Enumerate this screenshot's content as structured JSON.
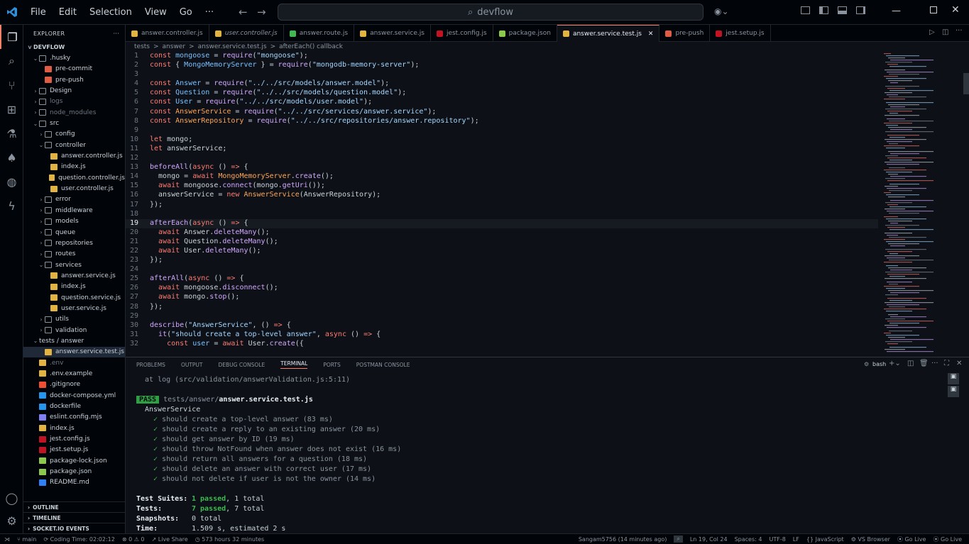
{
  "title_bar": {
    "menu": [
      "File",
      "Edit",
      "Selection",
      "View",
      "Go",
      "···"
    ],
    "search": "devflow"
  },
  "sidebar": {
    "header": "EXPLORER",
    "root": "DEVFLOW",
    "items": [
      {
        "label": ".husky",
        "indent": 1,
        "chev": "v",
        "type": "folder",
        "dim": false
      },
      {
        "label": "pre-commit",
        "indent": 2,
        "chev": "",
        "type": "husky",
        "dim": false
      },
      {
        "label": "pre-push",
        "indent": 2,
        "chev": "",
        "type": "husky",
        "dim": false
      },
      {
        "label": "Design",
        "indent": 1,
        "chev": ">",
        "type": "folder",
        "dim": false
      },
      {
        "label": "logs",
        "indent": 1,
        "chev": ">",
        "type": "folder",
        "dim": true
      },
      {
        "label": "node_modules",
        "indent": 1,
        "chev": ">",
        "type": "folder",
        "dim": true
      },
      {
        "label": "src",
        "indent": 1,
        "chev": "v",
        "type": "folder",
        "dim": false
      },
      {
        "label": "config",
        "indent": 2,
        "chev": ">",
        "type": "folder",
        "dim": false
      },
      {
        "label": "controller",
        "indent": 2,
        "chev": "v",
        "type": "folder",
        "dim": false
      },
      {
        "label": "answer.controller.js",
        "indent": 3,
        "chev": "",
        "type": "gear",
        "dim": false
      },
      {
        "label": "index.js",
        "indent": 3,
        "chev": "",
        "type": "js",
        "dim": false
      },
      {
        "label": "question.controller.js",
        "indent": 3,
        "chev": "",
        "type": "gear",
        "dim": false
      },
      {
        "label": "user.controller.js",
        "indent": 3,
        "chev": "",
        "type": "gear",
        "dim": false
      },
      {
        "label": "error",
        "indent": 2,
        "chev": ">",
        "type": "folder",
        "dim": false
      },
      {
        "label": "middleware",
        "indent": 2,
        "chev": ">",
        "type": "folder",
        "dim": false
      },
      {
        "label": "models",
        "indent": 2,
        "chev": ">",
        "type": "folder",
        "dim": false
      },
      {
        "label": "queue",
        "indent": 2,
        "chev": ">",
        "type": "folder",
        "dim": false
      },
      {
        "label": "repositories",
        "indent": 2,
        "chev": ">",
        "type": "folder",
        "dim": false
      },
      {
        "label": "routes",
        "indent": 2,
        "chev": ">",
        "type": "folder",
        "dim": false
      },
      {
        "label": "services",
        "indent": 2,
        "chev": "v",
        "type": "folder",
        "dim": false
      },
      {
        "label": "answer.service.js",
        "indent": 3,
        "chev": "",
        "type": "svc",
        "dim": false
      },
      {
        "label": "index.js",
        "indent": 3,
        "chev": "",
        "type": "js",
        "dim": false
      },
      {
        "label": "question.service.js",
        "indent": 3,
        "chev": "",
        "type": "svc",
        "dim": false
      },
      {
        "label": "user.service.js",
        "indent": 3,
        "chev": "",
        "type": "svc",
        "dim": false
      },
      {
        "label": "utils",
        "indent": 2,
        "chev": ">",
        "type": "folder",
        "dim": false
      },
      {
        "label": "validation",
        "indent": 2,
        "chev": ">",
        "type": "folder",
        "dim": false
      },
      {
        "label": "tests / answer",
        "indent": 1,
        "chev": "v",
        "type": "none",
        "dim": false
      },
      {
        "label": "answer.service.test.js",
        "indent": 2,
        "chev": "",
        "type": "svc",
        "dim": false,
        "selected": true
      },
      {
        "label": ".env",
        "indent": 1,
        "chev": "",
        "type": "env",
        "dim": true
      },
      {
        "label": ".env.example",
        "indent": 1,
        "chev": "",
        "type": "env",
        "dim": false
      },
      {
        "label": ".gitignore",
        "indent": 1,
        "chev": "",
        "type": "git",
        "dim": false
      },
      {
        "label": "docker-compose.yml",
        "indent": 1,
        "chev": "",
        "type": "docker",
        "dim": false
      },
      {
        "label": "dockerfile",
        "indent": 1,
        "chev": "",
        "type": "docker",
        "dim": false
      },
      {
        "label": "eslint.config.mjs",
        "indent": 1,
        "chev": "",
        "type": "eslint",
        "dim": false
      },
      {
        "label": "index.js",
        "indent": 1,
        "chev": "",
        "type": "js",
        "dim": false
      },
      {
        "label": "jest.config.js",
        "indent": 1,
        "chev": "",
        "type": "jest",
        "dim": false
      },
      {
        "label": "jest.setup.js",
        "indent": 1,
        "chev": "",
        "type": "jest",
        "dim": false
      },
      {
        "label": "package-lock.json",
        "indent": 1,
        "chev": "",
        "type": "node",
        "dim": false
      },
      {
        "label": "package.json",
        "indent": 1,
        "chev": "",
        "type": "node",
        "dim": false
      },
      {
        "label": "README.md",
        "indent": 1,
        "chev": "",
        "type": "info",
        "dim": false
      }
    ],
    "outline": "OUTLINE",
    "timeline": "TIMELINE",
    "socket": "SOCKET.IO EVENTS"
  },
  "tabs": [
    {
      "label": "answer.controller.js",
      "type": "gear",
      "active": false,
      "italic": false
    },
    {
      "label": "user.controller.js",
      "type": "gear",
      "active": false,
      "italic": true
    },
    {
      "label": "answer.route.js",
      "type": "route",
      "active": false,
      "italic": false
    },
    {
      "label": "answer.service.js",
      "type": "svc",
      "active": false,
      "italic": false
    },
    {
      "label": "jest.config.js",
      "type": "jest",
      "active": false,
      "italic": false
    },
    {
      "label": "package.json",
      "type": "node",
      "active": false,
      "italic": false
    },
    {
      "label": "answer.service.test.js",
      "type": "svc",
      "active": true,
      "italic": false
    },
    {
      "label": "pre-push",
      "type": "husky",
      "active": false,
      "italic": false
    },
    {
      "label": "jest.setup.js",
      "type": "jest",
      "active": false,
      "italic": false
    }
  ],
  "breadcrumb": [
    "tests",
    ">",
    "answer",
    ">",
    "answer.service.test.js",
    ">",
    "afterEach() callback"
  ],
  "code": [
    [
      [
        "k",
        "const "
      ],
      [
        "c",
        "mongoose"
      ],
      [
        "p",
        " = "
      ],
      [
        "f",
        "require"
      ],
      [
        "p",
        "("
      ],
      [
        "s",
        "\"mongoose\""
      ],
      [
        "p",
        ");"
      ]
    ],
    [
      [
        "k",
        "const "
      ],
      [
        "p",
        "{ "
      ],
      [
        "c",
        "MongoMemoryServer"
      ],
      [
        "p",
        " } = "
      ],
      [
        "f",
        "require"
      ],
      [
        "p",
        "("
      ],
      [
        "s",
        "\"mongodb-memory-server\""
      ],
      [
        "p",
        ");"
      ]
    ],
    [],
    [
      [
        "k",
        "const "
      ],
      [
        "c",
        "Answer"
      ],
      [
        "p",
        " = "
      ],
      [
        "f",
        "require"
      ],
      [
        "p",
        "("
      ],
      [
        "s",
        "\"../../src/models/answer.model\""
      ],
      [
        "p",
        ");"
      ]
    ],
    [
      [
        "k",
        "const "
      ],
      [
        "c",
        "Question"
      ],
      [
        "p",
        " = "
      ],
      [
        "f",
        "require"
      ],
      [
        "p",
        "("
      ],
      [
        "s",
        "\"../../src/models/question.model\""
      ],
      [
        "p",
        ");"
      ]
    ],
    [
      [
        "k",
        "const "
      ],
      [
        "c",
        "User"
      ],
      [
        "p",
        " = "
      ],
      [
        "f",
        "require"
      ],
      [
        "p",
        "("
      ],
      [
        "s",
        "\"../../src/models/user.model\""
      ],
      [
        "p",
        ");"
      ]
    ],
    [
      [
        "k",
        "const "
      ],
      [
        "v",
        "AnswerService"
      ],
      [
        "p",
        " = "
      ],
      [
        "f",
        "require"
      ],
      [
        "p",
        "("
      ],
      [
        "s",
        "\"../../src/services/answer.service\""
      ],
      [
        "p",
        ");"
      ]
    ],
    [
      [
        "k",
        "const "
      ],
      [
        "v",
        "AnswerRepository"
      ],
      [
        "p",
        " = "
      ],
      [
        "f",
        "require"
      ],
      [
        "p",
        "("
      ],
      [
        "s",
        "\"../../src/repositories/answer.repository\""
      ],
      [
        "p",
        ");"
      ]
    ],
    [],
    [
      [
        "k",
        "let "
      ],
      [
        "p",
        "mongo;"
      ]
    ],
    [
      [
        "k",
        "let "
      ],
      [
        "p",
        "answerService;"
      ]
    ],
    [],
    [
      [
        "f",
        "beforeAll"
      ],
      [
        "p",
        "("
      ],
      [
        "k",
        "async"
      ],
      [
        "p",
        " () "
      ],
      [
        "k",
        "=>"
      ],
      [
        "p",
        " {"
      ]
    ],
    [
      [
        "p",
        "  mongo = "
      ],
      [
        "k",
        "await "
      ],
      [
        "v",
        "MongoMemoryServer"
      ],
      [
        "p",
        "."
      ],
      [
        "f",
        "create"
      ],
      [
        "p",
        "();"
      ]
    ],
    [
      [
        "p",
        "  "
      ],
      [
        "k",
        "await "
      ],
      [
        "p",
        "mongoose."
      ],
      [
        "f",
        "connect"
      ],
      [
        "p",
        "(mongo."
      ],
      [
        "f",
        "getUri"
      ],
      [
        "p",
        "());"
      ]
    ],
    [
      [
        "p",
        "  answerService = "
      ],
      [
        "k",
        "new "
      ],
      [
        "v",
        "AnswerService"
      ],
      [
        "p",
        "(AnswerRepository);"
      ]
    ],
    [
      [
        "p",
        "});"
      ]
    ],
    [],
    [
      [
        "f",
        "afterEach"
      ],
      [
        "p",
        "("
      ],
      [
        "k",
        "async"
      ],
      [
        "p",
        " () "
      ],
      [
        "k",
        "=>"
      ],
      [
        "p",
        " {"
      ]
    ],
    [
      [
        "p",
        "  "
      ],
      [
        "k",
        "await "
      ],
      [
        "p",
        "Answer."
      ],
      [
        "f",
        "deleteMany"
      ],
      [
        "p",
        "();"
      ]
    ],
    [
      [
        "p",
        "  "
      ],
      [
        "k",
        "await "
      ],
      [
        "p",
        "Question."
      ],
      [
        "f",
        "deleteMany"
      ],
      [
        "p",
        "();"
      ]
    ],
    [
      [
        "p",
        "  "
      ],
      [
        "k",
        "await "
      ],
      [
        "p",
        "User."
      ],
      [
        "f",
        "deleteMany"
      ],
      [
        "p",
        "();"
      ]
    ],
    [
      [
        "p",
        "});"
      ]
    ],
    [],
    [
      [
        "f",
        "afterAll"
      ],
      [
        "p",
        "("
      ],
      [
        "k",
        "async"
      ],
      [
        "p",
        " () "
      ],
      [
        "k",
        "=>"
      ],
      [
        "p",
        " {"
      ]
    ],
    [
      [
        "p",
        "  "
      ],
      [
        "k",
        "await "
      ],
      [
        "p",
        "mongoose."
      ],
      [
        "f",
        "disconnect"
      ],
      [
        "p",
        "();"
      ]
    ],
    [
      [
        "p",
        "  "
      ],
      [
        "k",
        "await "
      ],
      [
        "p",
        "mongo."
      ],
      [
        "f",
        "stop"
      ],
      [
        "p",
        "();"
      ]
    ],
    [
      [
        "p",
        "});"
      ]
    ],
    [],
    [
      [
        "f",
        "describe"
      ],
      [
        "p",
        "("
      ],
      [
        "s",
        "\"AnswerService\""
      ],
      [
        "p",
        ", () "
      ],
      [
        "k",
        "=>"
      ],
      [
        "p",
        " {"
      ]
    ],
    [
      [
        "p",
        "  "
      ],
      [
        "f",
        "it"
      ],
      [
        "p",
        "("
      ],
      [
        "s",
        "\"should create a top-level answer\""
      ],
      [
        "p",
        ", "
      ],
      [
        "k",
        "async"
      ],
      [
        "p",
        " () "
      ],
      [
        "k",
        "=>"
      ],
      [
        "p",
        " {"
      ]
    ],
    [
      [
        "p",
        "    "
      ],
      [
        "k",
        "const "
      ],
      [
        "c",
        "user"
      ],
      [
        "p",
        " = "
      ],
      [
        "k",
        "await "
      ],
      [
        "p",
        "User."
      ],
      [
        "f",
        "create"
      ],
      [
        "p",
        "({"
      ]
    ]
  ],
  "current_line": 19,
  "panel_tabs": [
    "PROBLEMS",
    "OUTPUT",
    "DEBUG CONSOLE",
    "TERMINAL",
    "PORTS",
    "POSTMAN CONSOLE"
  ],
  "terminal": {
    "shell": "bash",
    "log_line": "  at log (src/validation/answerValidation.js:5:11)",
    "pass_badge": "PASS",
    "pass_path_dim": "tests/answer/",
    "pass_path_bold": "answer.service.test.js",
    "suite": "AnswerService",
    "tests": [
      "should create a top-level answer (83 ms)",
      "should create a reply to an existing answer (20 ms)",
      "should get answer by ID (19 ms)",
      "should throw NotFound when answer does not exist (16 ms)",
      "should return all answers for a question (18 ms)",
      "should delete an answer with correct user (17 ms)",
      "should not delete if user is not the owner (14 ms)"
    ],
    "check": "✓",
    "summary_suites_label": "Test Suites:",
    "summary_suites_pass": "1 passed",
    ",_": "",
    "summary_suites_rest": ", 1 total",
    "summary_tests_label": "Tests:",
    "summary_tests_pass": "7 passed",
    "summary_tests_rest": ", 7 total",
    "summary_snap_label": "Snapshots:",
    "summary_snap_val": "0 total",
    "summary_time_label": "Time:",
    "summary_time_val": "1.509 s, estimated 2 s"
  },
  "status": {
    "branch": "main",
    "coding_time": "Coding Time: 02:02:12",
    "problems": "0 ⚠ 0",
    "live_share": "Live Share",
    "hours": "573 hours 32 minutes",
    "blame": "Sangam5756 (14 minutes ago)",
    "position": "Ln 19, Col 24",
    "spaces": "Spaces: 4",
    "encoding": "UTF-8",
    "eol": "LF",
    "language": "JavaScript",
    "vs_browser": "VS Browser",
    "go_live": "Go Live",
    "go_live2": "Go Live"
  },
  "colors": {
    "accent": "#f78166",
    "pass_bg": "#2ea043",
    "keyword": "#ff7b72",
    "string": "#a5d6ff",
    "function": "#d2a8ff"
  }
}
